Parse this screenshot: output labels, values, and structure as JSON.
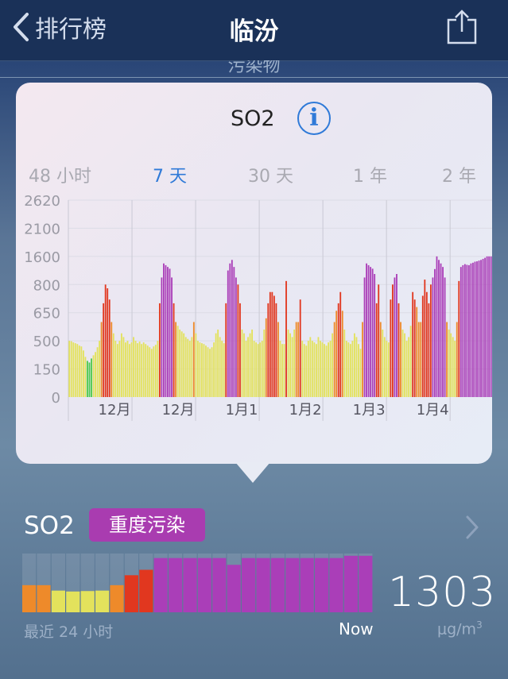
{
  "nav": {
    "back_label": "排行榜",
    "title": "临汾",
    "subtitle": "污染物"
  },
  "popup": {
    "title": "SO2",
    "info_symbol": "i",
    "ranges": [
      "48 小时",
      "7 天",
      "30 天",
      "1 年",
      "2 年"
    ],
    "active_range": 1
  },
  "chart_data": {
    "type": "bar",
    "y_ticks": [
      "0",
      "150",
      "500",
      "650",
      "800",
      "1600",
      "2100",
      "2620"
    ],
    "x_ticks": [
      "12月",
      "12月",
      "1月1",
      "1月2",
      "1月3",
      "1月4"
    ],
    "grid": true,
    "values": [
      500,
      495,
      480,
      470,
      460,
      440,
      430,
      380,
      300,
      250,
      230,
      280,
      320,
      360,
      420,
      500,
      600,
      700,
      800,
      780,
      720,
      600,
      540,
      500,
      460,
      500,
      540,
      520,
      480,
      500,
      460,
      480,
      520,
      500,
      470,
      490,
      460,
      480,
      460,
      440,
      420,
      400,
      430,
      450,
      500,
      700,
      1000,
      1400,
      1350,
      1300,
      1250,
      1000,
      700,
      600,
      580,
      560,
      550,
      540,
      520,
      510,
      500,
      520,
      600,
      540,
      500,
      480,
      470,
      460,
      440,
      420,
      400,
      420,
      480,
      540,
      560,
      520,
      500,
      470,
      700,
      1200,
      1400,
      1500,
      1300,
      1000,
      800,
      700,
      560,
      540,
      500,
      520,
      540,
      560,
      500,
      480,
      460,
      480,
      500,
      560,
      620,
      700,
      760,
      760,
      740,
      700,
      600,
      500,
      460,
      460,
      900,
      560,
      540,
      520,
      560,
      600,
      600,
      720,
      500,
      460,
      440,
      500,
      520,
      500,
      480,
      460,
      520,
      500,
      480,
      460,
      440,
      480,
      500,
      540,
      600,
      660,
      700,
      760,
      660,
      560,
      500,
      480,
      460,
      500,
      540,
      520,
      460,
      400,
      600,
      1000,
      1400,
      1350,
      1300,
      1250,
      1100,
      700,
      800,
      600,
      560,
      520,
      500,
      480,
      720,
      800,
      1000,
      1100,
      700,
      600,
      560,
      540,
      500,
      520,
      580,
      760,
      720,
      680,
      600,
      600,
      740,
      940,
      760,
      700,
      800,
      1000,
      1240,
      1600,
      1500,
      1400,
      1300,
      1000,
      600,
      560,
      540,
      520,
      500,
      600,
      900,
      1300,
      1350,
      1380,
      1360,
      1350,
      1400,
      1420,
      1450,
      1460,
      1480,
      1500,
      1530,
      1560,
      1600,
      1600,
      1600
    ]
  },
  "current": {
    "pollutant": "SO2",
    "badge": "重度污染",
    "value": "1303",
    "recent_label": "最近 24 小时",
    "now_label": "Now",
    "unit": "μg/m",
    "unit_sup": "3",
    "hourly_24h": [
      600,
      600,
      480,
      460,
      470,
      480,
      600,
      820,
      940,
      1200,
      1200,
      1200,
      1200,
      1200,
      1050,
      1200,
      1200,
      1200,
      1200,
      1200,
      1200,
      1200,
      1250,
      1250
    ]
  },
  "colors": {
    "green": "#4cc94c",
    "yellow": "#e3e25c",
    "orange": "#ee8a2a",
    "red": "#e1371f",
    "purple": "#aa3eb8",
    "accent": "#2f7ad8",
    "badge": "#a93cb0"
  }
}
